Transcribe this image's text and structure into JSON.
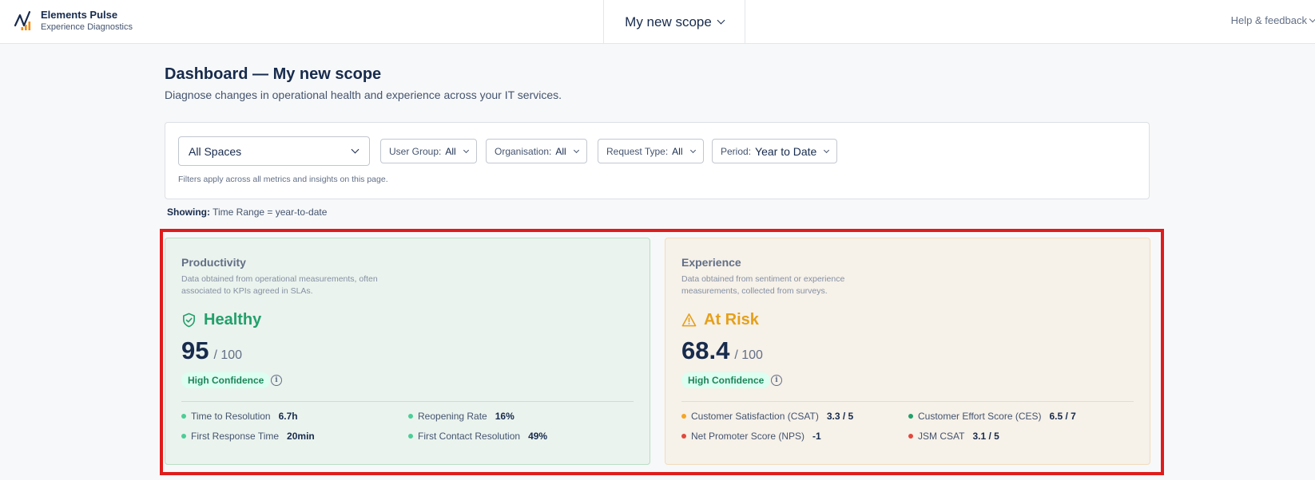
{
  "header": {
    "brand_name": "Elements Pulse",
    "brand_sub": "Experience Diagnostics",
    "scope": "My new scope",
    "help": "Help & feedback"
  },
  "page": {
    "title": "Dashboard — My new scope",
    "subtitle": "Diagnose changes in operational health and experience across your IT services."
  },
  "filters": {
    "spaces": "All Spaces",
    "user_group": {
      "label": "User Group:",
      "value": "All"
    },
    "organisation": {
      "label": "Organisation:",
      "value": "All"
    },
    "request_type": {
      "label": "Request Type:",
      "value": "All"
    },
    "period": {
      "label": "Period:",
      "value": "Year to Date"
    },
    "hint": "Filters apply across all metrics and insights on this page."
  },
  "showing": {
    "label": "Showing:",
    "value": "Time Range = year-to-date"
  },
  "productivity": {
    "title": "Productivity",
    "desc": "Data obtained from operational measurements, often associated to KPIs agreed in SLAs.",
    "status": "Healthy",
    "status_color": "#22a06b",
    "score": "95",
    "of": "/ 100",
    "confidence": "High Confidence",
    "metrics": [
      {
        "label": "Time to Resolution",
        "value": "6.7h",
        "color": "#4bce97"
      },
      {
        "label": "Reopening Rate",
        "value": "16%",
        "color": "#4bce97"
      },
      {
        "label": "First Response Time",
        "value": "20min",
        "color": "#4bce97"
      },
      {
        "label": "First Contact Resolution",
        "value": "49%",
        "color": "#4bce97"
      }
    ]
  },
  "experience": {
    "title": "Experience",
    "desc": "Data obtained from sentiment or experience measurements, collected from surveys.",
    "status": "At Risk",
    "status_color": "#e5a01b",
    "score": "68.4",
    "of": "/ 100",
    "confidence": "High Confidence",
    "metrics": [
      {
        "label": "Customer Satisfaction (CSAT)",
        "value": "3.3 / 5",
        "color": "#f5a623"
      },
      {
        "label": "Customer Effort Score (CES)",
        "value": "6.5 / 7",
        "color": "#22a06b"
      },
      {
        "label": "Net Promoter Score (NPS)",
        "value": "-1",
        "color": "#e2483d"
      },
      {
        "label": "JSM CSAT",
        "value": "3.1 / 5",
        "color": "#e2483d"
      }
    ]
  }
}
